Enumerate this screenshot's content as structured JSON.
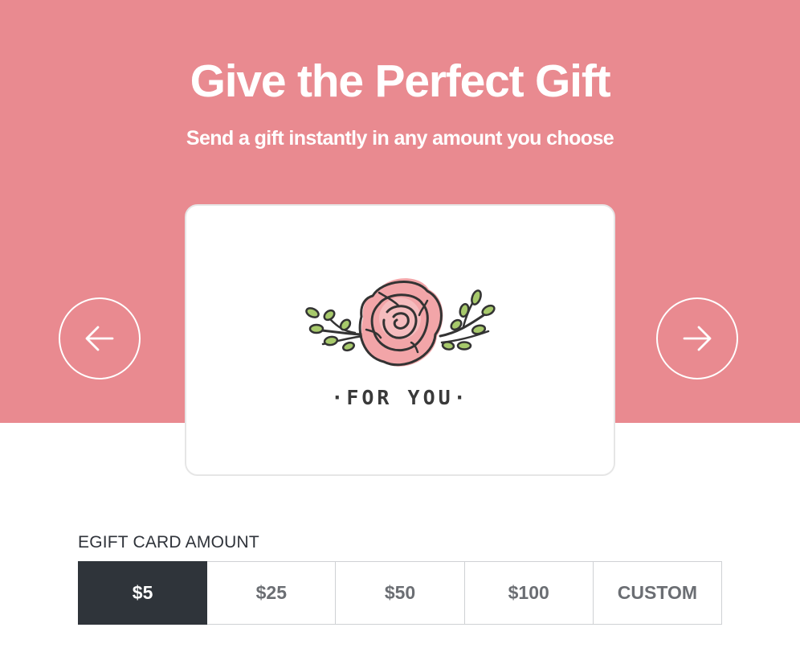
{
  "hero": {
    "title": "Give the Perfect Gift",
    "subtitle": "Send a gift instantly in any amount you choose",
    "background_color": "#e98a90"
  },
  "carousel": {
    "prev_icon": "arrow-left-icon",
    "next_icon": "arrow-right-icon",
    "card": {
      "illustration": "rose-with-leaves",
      "text": "·FOR YOU·"
    }
  },
  "amount": {
    "label": "EGIFT CARD AMOUNT",
    "selected": "$5",
    "options": [
      "$5",
      "$25",
      "$50",
      "$100",
      "CUSTOM"
    ],
    "selected_color": "#2f343a"
  }
}
